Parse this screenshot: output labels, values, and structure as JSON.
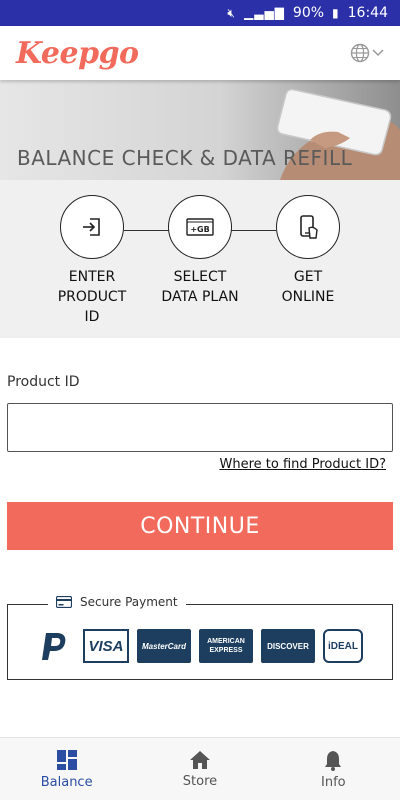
{
  "status_bar": {
    "battery": "90%",
    "time": "16:44"
  },
  "app": {
    "logo_text": "Keepgo"
  },
  "hero": {
    "title": "BALANCE CHECK & DATA REFILL"
  },
  "steps": [
    {
      "label_line1": "ENTER",
      "label_line2": "PRODUCT",
      "label_line3": "ID",
      "icon": "enter-icon"
    },
    {
      "label_line1": "SELECT",
      "label_line2": "DATA PLAN",
      "icon": "data-plan-icon",
      "icon_text": "+GB"
    },
    {
      "label_line1": "GET",
      "label_line2": "ONLINE",
      "icon": "phone-online-icon"
    }
  ],
  "form": {
    "product_id_label": "Product ID",
    "product_id_value": "",
    "product_id_placeholder": "",
    "help_link": "Where to find Product ID?",
    "continue_label": "CONTINUE"
  },
  "secure_payment": {
    "title": "Secure Payment",
    "methods": [
      "PayPal",
      "VISA",
      "MasterCard",
      "AMERICAN EXPRESS",
      "DISCOVER",
      "iDEAL"
    ]
  },
  "bottom_nav": {
    "items": [
      {
        "label": "Balance",
        "icon": "grid-icon",
        "active": true
      },
      {
        "label": "Store",
        "icon": "home-icon",
        "active": false
      },
      {
        "label": "Info",
        "icon": "bell-icon",
        "active": false
      }
    ]
  },
  "colors": {
    "accent": "#f26a5b",
    "status_bar": "#2b2fa8",
    "nav_active": "#2b4ea3",
    "card_brand": "#1d3e5e"
  }
}
